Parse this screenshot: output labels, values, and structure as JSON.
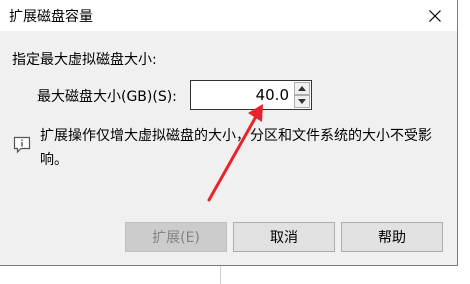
{
  "dialog": {
    "title": "扩展磁盘容量",
    "section_label": "指定最大虚拟磁盘大小:",
    "size_label": "最大磁盘大小(GB)(S):",
    "size_value": "40.0",
    "info_text": "扩展操作仅增大虚拟磁盘的大小，分区和文件系统的大小不受影响。",
    "buttons": {
      "expand": "扩展(E)",
      "cancel": "取消",
      "help": "帮助"
    }
  },
  "annotation": {
    "arrow_color": "#e8232b"
  },
  "icons": {
    "close": "close-icon",
    "info": "info-comment-icon",
    "spin_up": "chevron-up-icon",
    "spin_down": "chevron-down-icon"
  }
}
